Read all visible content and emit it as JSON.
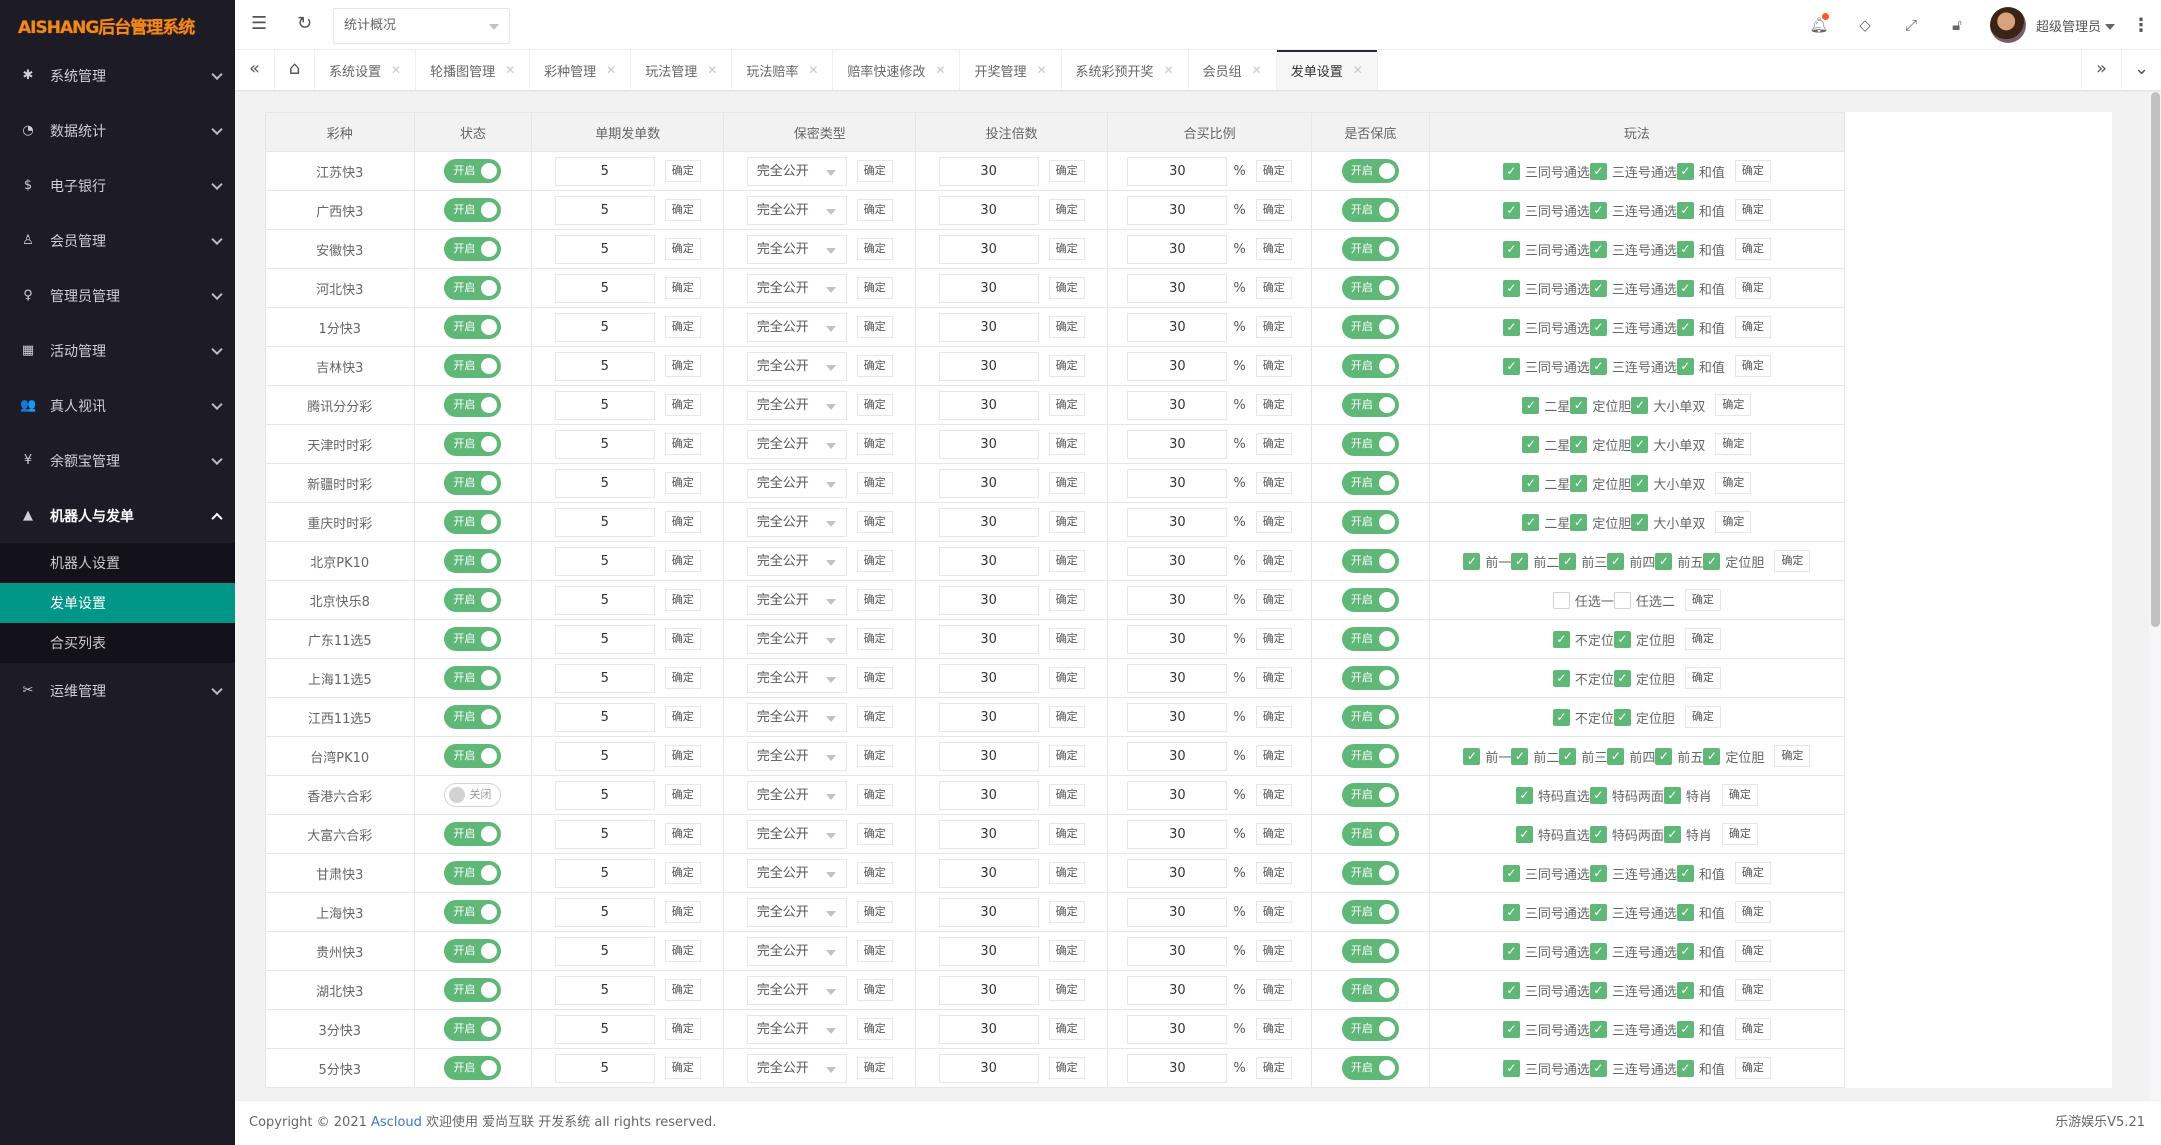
{
  "app": {
    "logo": "AISHANG后台管理系统"
  },
  "sidebar": {
    "items": [
      {
        "label": "系统管理",
        "icon": "gear-icon",
        "glyph": "✱"
      },
      {
        "label": "数据统计",
        "icon": "dashboard-icon",
        "glyph": "◔"
      },
      {
        "label": "电子银行",
        "icon": "dollar-icon",
        "glyph": "$"
      },
      {
        "label": "会员管理",
        "icon": "users-icon",
        "glyph": "♙"
      },
      {
        "label": "管理员管理",
        "icon": "user-icon",
        "glyph": "♀"
      },
      {
        "label": "活动管理",
        "icon": "gift-icon",
        "glyph": "▦"
      },
      {
        "label": "真人视讯",
        "icon": "group-icon",
        "glyph": "👥"
      },
      {
        "label": "余额宝管理",
        "icon": "yen-icon",
        "glyph": "¥"
      },
      {
        "label": "机器人与发单",
        "icon": "person-icon",
        "glyph": "▲"
      },
      {
        "label": "运维管理",
        "icon": "tools-icon",
        "glyph": "✂"
      }
    ],
    "submenu": [
      "机器人设置",
      "发单设置",
      "合买列表"
    ],
    "active_sub": "发单设置"
  },
  "header": {
    "select_value": "统计概况",
    "user_name": "超级管理员",
    "notification_dot_color": "#ff5722"
  },
  "tabs": {
    "items": [
      "系统设置",
      "轮播图管理",
      "彩种管理",
      "玩法管理",
      "玩法赔率",
      "赔率快速修改",
      "开奖管理",
      "系统彩预开奖",
      "会员组",
      "发单设置"
    ],
    "active": "发单设置"
  },
  "table": {
    "headers": [
      "彩种",
      "状态",
      "单期发单数",
      "保密类型",
      "投注倍数",
      "合买比例",
      "是否保底",
      "玩法"
    ],
    "confirm_label": "确定",
    "switch_on": "开启",
    "switch_off": "关闭",
    "percent": "%",
    "rows": [
      {
        "name": "江苏快3",
        "status": "开启",
        "per_issue": "5",
        "secrecy": "完全公开",
        "multiple": "30",
        "ratio": "30",
        "guarantee": "开启",
        "plays": [
          [
            "三同号通选",
            true
          ],
          [
            "三连号通选",
            true
          ],
          [
            "和值",
            true
          ]
        ]
      },
      {
        "name": "广西快3",
        "status": "开启",
        "per_issue": "5",
        "secrecy": "完全公开",
        "multiple": "30",
        "ratio": "30",
        "guarantee": "开启",
        "plays": [
          [
            "三同号通选",
            true
          ],
          [
            "三连号通选",
            true
          ],
          [
            "和值",
            true
          ]
        ]
      },
      {
        "name": "安徽快3",
        "status": "开启",
        "per_issue": "5",
        "secrecy": "完全公开",
        "multiple": "30",
        "ratio": "30",
        "guarantee": "开启",
        "plays": [
          [
            "三同号通选",
            true
          ],
          [
            "三连号通选",
            true
          ],
          [
            "和值",
            true
          ]
        ]
      },
      {
        "name": "河北快3",
        "status": "开启",
        "per_issue": "5",
        "secrecy": "完全公开",
        "multiple": "30",
        "ratio": "30",
        "guarantee": "开启",
        "plays": [
          [
            "三同号通选",
            true
          ],
          [
            "三连号通选",
            true
          ],
          [
            "和值",
            true
          ]
        ]
      },
      {
        "name": "1分快3",
        "status": "开启",
        "per_issue": "5",
        "secrecy": "完全公开",
        "multiple": "30",
        "ratio": "30",
        "guarantee": "开启",
        "plays": [
          [
            "三同号通选",
            true
          ],
          [
            "三连号通选",
            true
          ],
          [
            "和值",
            true
          ]
        ]
      },
      {
        "name": "吉林快3",
        "status": "开启",
        "per_issue": "5",
        "secrecy": "完全公开",
        "multiple": "30",
        "ratio": "30",
        "guarantee": "开启",
        "plays": [
          [
            "三同号通选",
            true
          ],
          [
            "三连号通选",
            true
          ],
          [
            "和值",
            true
          ]
        ]
      },
      {
        "name": "腾讯分分彩",
        "status": "开启",
        "per_issue": "5",
        "secrecy": "完全公开",
        "multiple": "30",
        "ratio": "30",
        "guarantee": "开启",
        "plays": [
          [
            "二星",
            true
          ],
          [
            "定位胆",
            true
          ],
          [
            "大小单双",
            true
          ]
        ]
      },
      {
        "name": "天津时时彩",
        "status": "开启",
        "per_issue": "5",
        "secrecy": "完全公开",
        "multiple": "30",
        "ratio": "30",
        "guarantee": "开启",
        "plays": [
          [
            "二星",
            true
          ],
          [
            "定位胆",
            true
          ],
          [
            "大小单双",
            true
          ]
        ]
      },
      {
        "name": "新疆时时彩",
        "status": "开启",
        "per_issue": "5",
        "secrecy": "完全公开",
        "multiple": "30",
        "ratio": "30",
        "guarantee": "开启",
        "plays": [
          [
            "二星",
            true
          ],
          [
            "定位胆",
            true
          ],
          [
            "大小单双",
            true
          ]
        ]
      },
      {
        "name": "重庆时时彩",
        "status": "开启",
        "per_issue": "5",
        "secrecy": "完全公开",
        "multiple": "30",
        "ratio": "30",
        "guarantee": "开启",
        "plays": [
          [
            "二星",
            true
          ],
          [
            "定位胆",
            true
          ],
          [
            "大小单双",
            true
          ]
        ]
      },
      {
        "name": "北京PK10",
        "status": "开启",
        "per_issue": "5",
        "secrecy": "完全公开",
        "multiple": "30",
        "ratio": "30",
        "guarantee": "开启",
        "plays": [
          [
            "前一",
            true
          ],
          [
            "前二",
            true
          ],
          [
            "前三",
            true
          ],
          [
            "前四",
            true
          ],
          [
            "前五",
            true
          ],
          [
            "定位胆",
            true
          ]
        ]
      },
      {
        "name": "北京快乐8",
        "status": "开启",
        "per_issue": "5",
        "secrecy": "完全公开",
        "multiple": "30",
        "ratio": "30",
        "guarantee": "开启",
        "plays": [
          [
            "任选一",
            false
          ],
          [
            "任选二",
            false
          ]
        ]
      },
      {
        "name": "广东11选5",
        "status": "开启",
        "per_issue": "5",
        "secrecy": "完全公开",
        "multiple": "30",
        "ratio": "30",
        "guarantee": "开启",
        "plays": [
          [
            "不定位",
            true
          ],
          [
            "定位胆",
            true
          ]
        ]
      },
      {
        "name": "上海11选5",
        "status": "开启",
        "per_issue": "5",
        "secrecy": "完全公开",
        "multiple": "30",
        "ratio": "30",
        "guarantee": "开启",
        "plays": [
          [
            "不定位",
            true
          ],
          [
            "定位胆",
            true
          ]
        ]
      },
      {
        "name": "江西11选5",
        "status": "开启",
        "per_issue": "5",
        "secrecy": "完全公开",
        "multiple": "30",
        "ratio": "30",
        "guarantee": "开启",
        "plays": [
          [
            "不定位",
            true
          ],
          [
            "定位胆",
            true
          ]
        ]
      },
      {
        "name": "台湾PK10",
        "status": "开启",
        "per_issue": "5",
        "secrecy": "完全公开",
        "multiple": "30",
        "ratio": "30",
        "guarantee": "开启",
        "plays": [
          [
            "前一",
            true
          ],
          [
            "前二",
            true
          ],
          [
            "前三",
            true
          ],
          [
            "前四",
            true
          ],
          [
            "前五",
            true
          ],
          [
            "定位胆",
            true
          ]
        ]
      },
      {
        "name": "香港六合彩",
        "status": "关闭",
        "per_issue": "5",
        "secrecy": "完全公开",
        "multiple": "30",
        "ratio": "30",
        "guarantee": "开启",
        "plays": [
          [
            "特码直选",
            true
          ],
          [
            "特码两面",
            true
          ],
          [
            "特肖",
            true
          ]
        ]
      },
      {
        "name": "大富六合彩",
        "status": "开启",
        "per_issue": "5",
        "secrecy": "完全公开",
        "multiple": "30",
        "ratio": "30",
        "guarantee": "开启",
        "plays": [
          [
            "特码直选",
            true
          ],
          [
            "特码两面",
            true
          ],
          [
            "特肖",
            true
          ]
        ]
      },
      {
        "name": "甘肃快3",
        "status": "开启",
        "per_issue": "5",
        "secrecy": "完全公开",
        "multiple": "30",
        "ratio": "30",
        "guarantee": "开启",
        "plays": [
          [
            "三同号通选",
            true
          ],
          [
            "三连号通选",
            true
          ],
          [
            "和值",
            true
          ]
        ]
      },
      {
        "name": "上海快3",
        "status": "开启",
        "per_issue": "5",
        "secrecy": "完全公开",
        "multiple": "30",
        "ratio": "30",
        "guarantee": "开启",
        "plays": [
          [
            "三同号通选",
            true
          ],
          [
            "三连号通选",
            true
          ],
          [
            "和值",
            true
          ]
        ]
      },
      {
        "name": "贵州快3",
        "status": "开启",
        "per_issue": "5",
        "secrecy": "完全公开",
        "multiple": "30",
        "ratio": "30",
        "guarantee": "开启",
        "plays": [
          [
            "三同号通选",
            true
          ],
          [
            "三连号通选",
            true
          ],
          [
            "和值",
            true
          ]
        ]
      },
      {
        "name": "湖北快3",
        "status": "开启",
        "per_issue": "5",
        "secrecy": "完全公开",
        "multiple": "30",
        "ratio": "30",
        "guarantee": "开启",
        "plays": [
          [
            "三同号通选",
            true
          ],
          [
            "三连号通选",
            true
          ],
          [
            "和值",
            true
          ]
        ]
      },
      {
        "name": "3分快3",
        "status": "开启",
        "per_issue": "5",
        "secrecy": "完全公开",
        "multiple": "30",
        "ratio": "30",
        "guarantee": "开启",
        "plays": [
          [
            "三同号通选",
            true
          ],
          [
            "三连号通选",
            true
          ],
          [
            "和值",
            true
          ]
        ]
      },
      {
        "name": "5分快3",
        "status": "开启",
        "per_issue": "5",
        "secrecy": "完全公开",
        "multiple": "30",
        "ratio": "30",
        "guarantee": "开启",
        "plays": [
          [
            "三同号通选",
            true
          ],
          [
            "三连号通选",
            true
          ],
          [
            "和值",
            true
          ]
        ]
      }
    ]
  },
  "footer": {
    "prefix": "Copyright © 2021 ",
    "link": "Ascloud",
    "suffix": " 欢迎使用 爱尚互联 开发系统 all rights reserved.",
    "version": "乐游娱乐V5.21"
  },
  "colors": {
    "accent": "#009688",
    "switch_on": "#5fb878",
    "sidebar_bg": "#1c1b26",
    "logo": "#f08a1c"
  }
}
